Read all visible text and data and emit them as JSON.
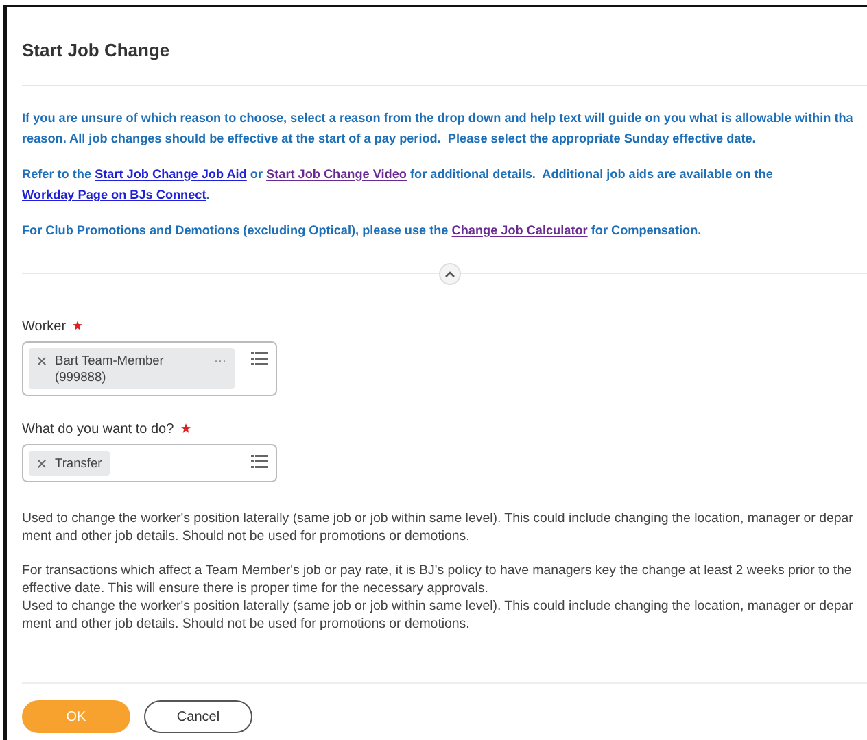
{
  "title": "Start Job Change",
  "intro": [
    [
      {
        "kind": "text",
        "text": "If you are unsure of which reason to choose, select a reason from the drop down and help text will guide on you what is allowable within tha"
      },
      {
        "kind": "break"
      },
      {
        "kind": "text",
        "text": "reason. All job changes should be effective at the start of a pay period.  Please select the appropriate Sunday effective date."
      }
    ],
    [
      {
        "kind": "text",
        "text": "Refer to the "
      },
      {
        "kind": "link",
        "text": "Start Job Change Job Aid",
        "visited": false
      },
      {
        "kind": "text",
        "text": " or "
      },
      {
        "kind": "link",
        "text": "Start Job Change Video",
        "visited": true
      },
      {
        "kind": "text",
        "text": " for additional details.  Additional job aids are available on the "
      },
      {
        "kind": "link",
        "text": "Workday Page on BJs Connect",
        "visited": false
      },
      {
        "kind": "text",
        "text": "."
      }
    ],
    [
      {
        "kind": "text",
        "text": "For Club Promotions and Demotions (excluding Optical), please use the "
      },
      {
        "kind": "link",
        "text": "Change Job Calculator",
        "visited": true
      },
      {
        "kind": "text",
        "text": " for Compensation."
      }
    ]
  ],
  "fields": [
    {
      "label": "Worker",
      "required": true,
      "value": "Bart Team-Member (999888)",
      "more": "···"
    },
    {
      "label": "What do you want to do?",
      "required": true,
      "value": "Transfer"
    }
  ],
  "help": [
    [
      "Used to change the worker's position laterally (same job or job within same level). This could include changing the location, manager or depar",
      "ment and other job details. Should not be used for promotions or demotions."
    ],
    [
      "For transactions which affect a Team Member's job or pay rate, it is BJ's policy to have managers key the change at least 2 weeks prior to the",
      "effective date.  This will ensure there is proper time for the necessary approvals.",
      "Used to change the worker's position laterally (same job or job within same level). This could include changing the location, manager or depar",
      "ment and other job details. Should not be used for promotions or demotions."
    ]
  ],
  "buttons": [
    {
      "label": "OK",
      "kind": "primary"
    },
    {
      "label": "Cancel",
      "kind": "secondary"
    }
  ]
}
